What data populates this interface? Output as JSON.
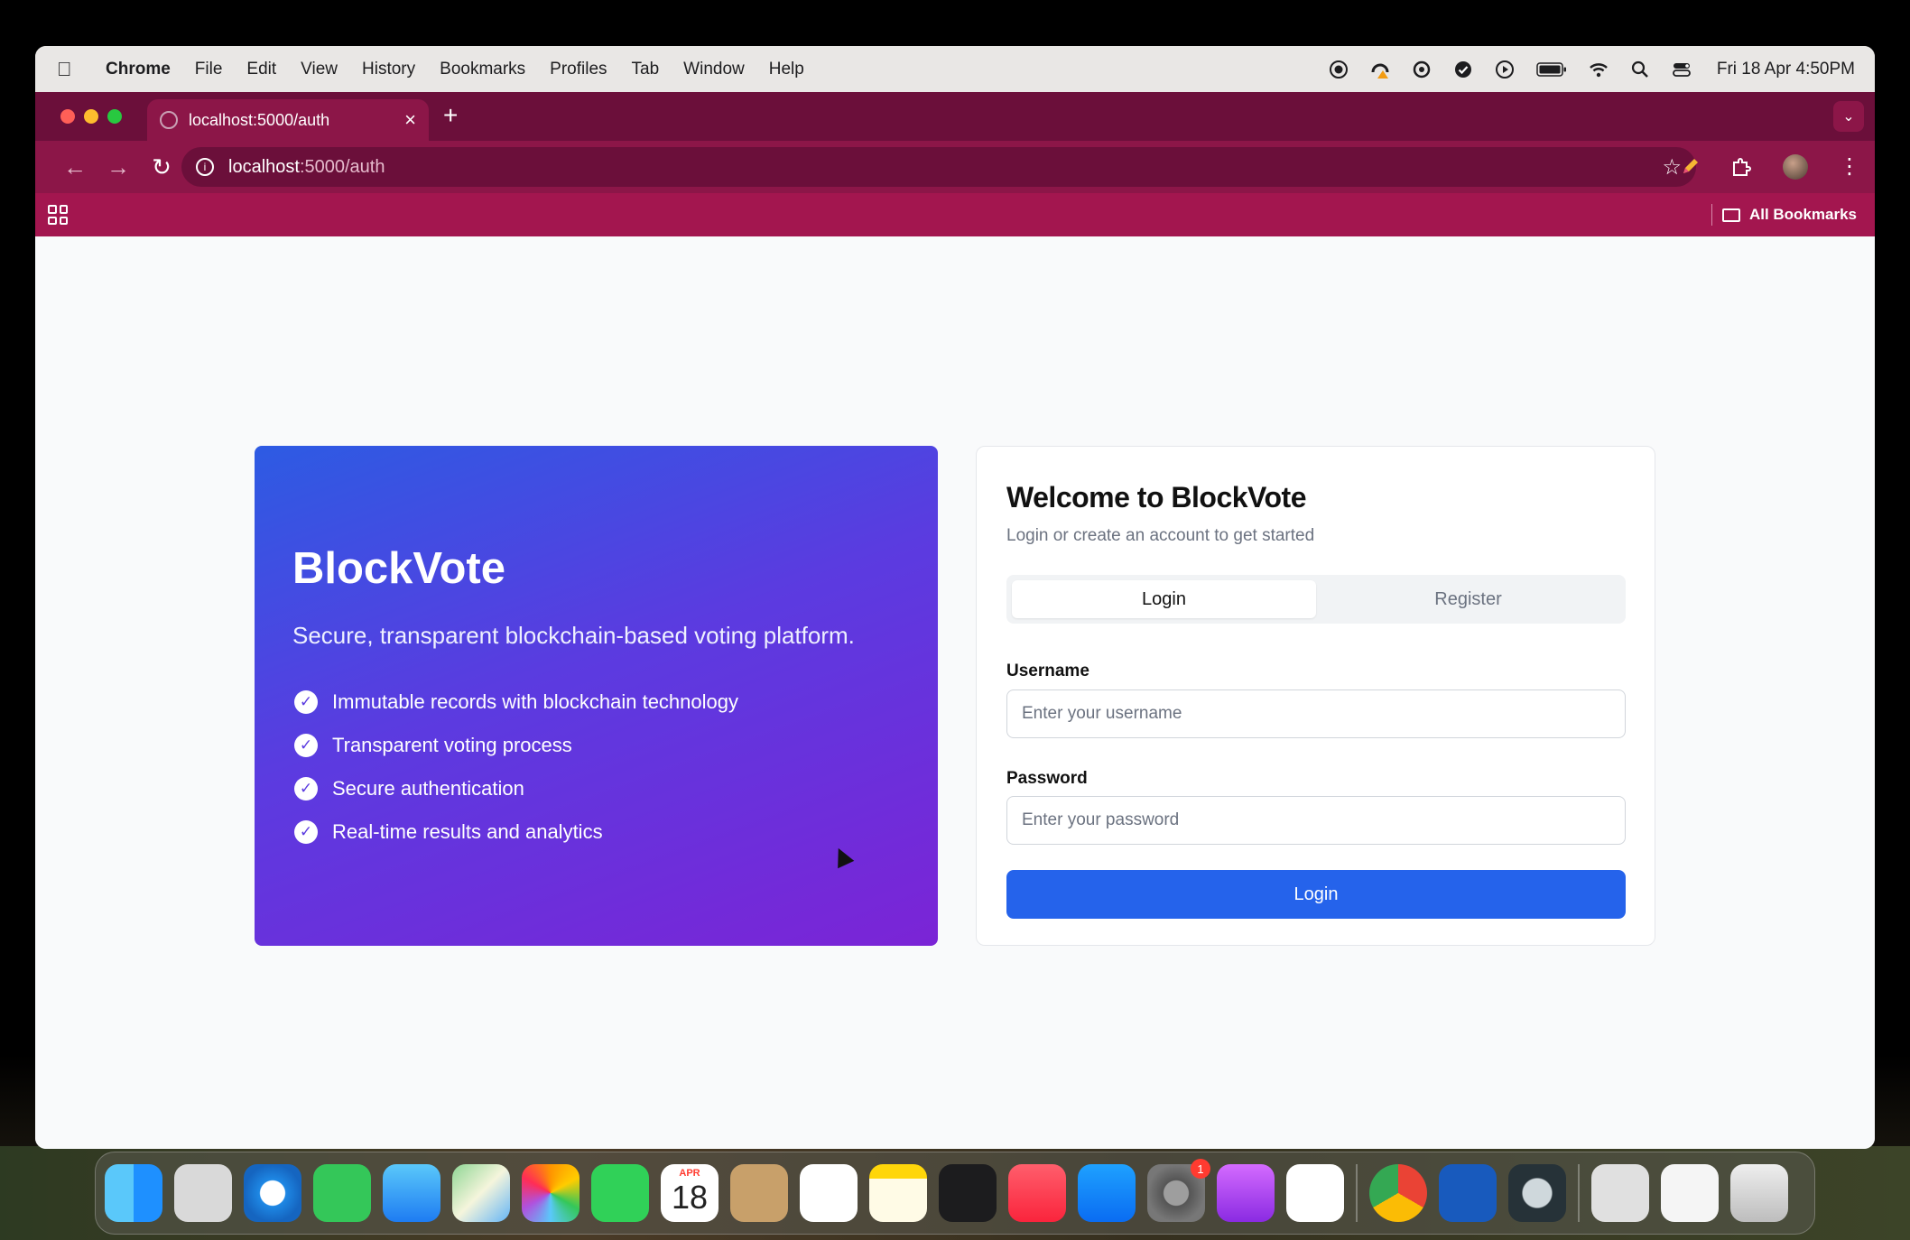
{
  "menubar": {
    "app_name": "Chrome",
    "items": [
      "File",
      "Edit",
      "View",
      "History",
      "Bookmarks",
      "Profiles",
      "Tab",
      "Window",
      "Help"
    ],
    "clock": "Fri 18 Apr  4:50PM"
  },
  "browser": {
    "tab_title": "localhost:5000/auth",
    "url_host": "localhost",
    "url_path": ":5000/auth",
    "bookmarks_label": "All Bookmarks",
    "theme_colors": {
      "tabstrip": "#6b0f3a",
      "toolbar": "#8c1648",
      "bookmarks": "#a3164f"
    }
  },
  "hero": {
    "title": "BlockVote",
    "tagline": "Secure, transparent blockchain-based voting platform.",
    "features": [
      "Immutable records with blockchain technology",
      "Transparent voting process",
      "Secure authentication",
      "Real-time results and analytics"
    ]
  },
  "auth": {
    "title": "Welcome to BlockVote",
    "subtitle": "Login or create an account to get started",
    "tabs": {
      "login": "Login",
      "register": "Register",
      "active": "Login"
    },
    "username_label": "Username",
    "username_placeholder": "Enter your username",
    "username_value": "",
    "password_label": "Password",
    "password_placeholder": "Enter your password",
    "password_value": "",
    "submit_label": "Login",
    "accent_color": "#2563eb"
  },
  "dock": {
    "calendar_month": "APR",
    "calendar_day": "18",
    "settings_badge": "1"
  }
}
